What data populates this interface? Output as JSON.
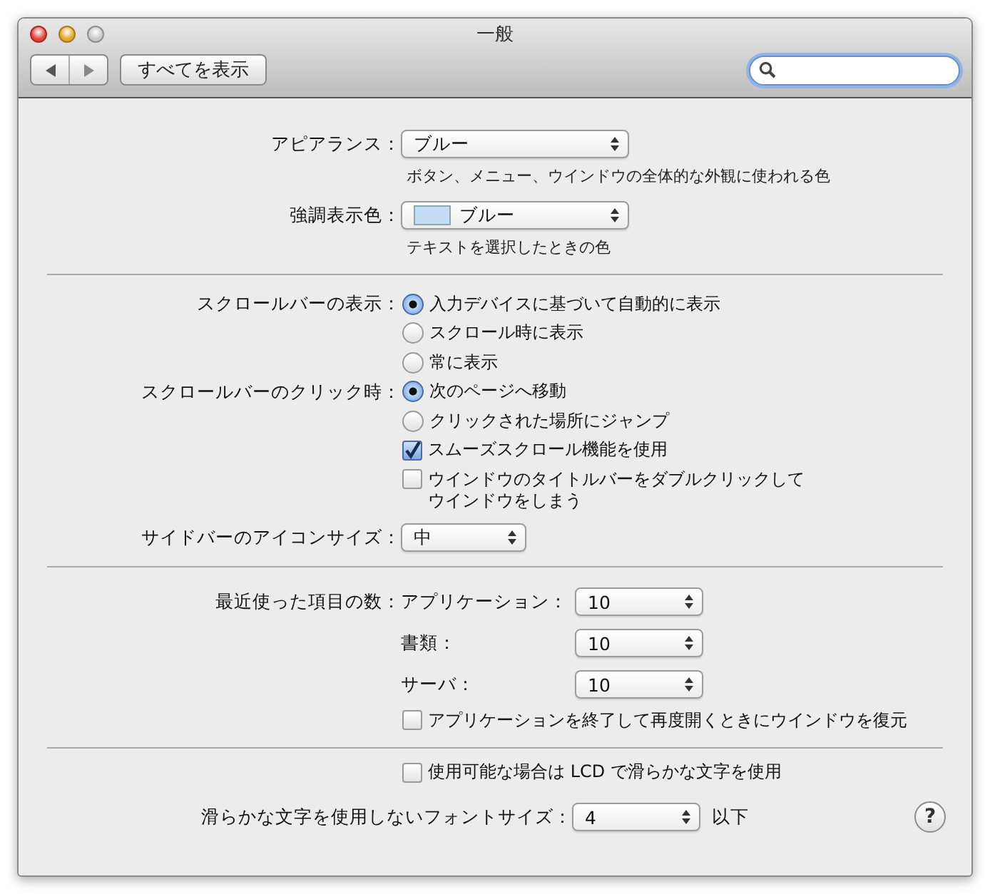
{
  "window": {
    "title": "一般"
  },
  "toolbar": {
    "show_all": "すべてを表示"
  },
  "appearance": {
    "label": "アピアランス：",
    "value": "ブルー",
    "hint": "ボタン、メニュー、ウインドウの全体的な外観に使われる色"
  },
  "highlight": {
    "label": "強調表示色：",
    "color": "#c5dcf7",
    "value": "ブルー",
    "hint": "テキストを選択したときの色"
  },
  "scroll_display": {
    "label": "スクロールバーの表示：",
    "options": [
      {
        "label": "入力デバイスに基づいて自動的に表示",
        "selected": true
      },
      {
        "label": "スクロール時に表示",
        "selected": false
      },
      {
        "label": "常に表示",
        "selected": false
      }
    ]
  },
  "scroll_click": {
    "label": "スクロールバーのクリック時：",
    "options": [
      {
        "label": "次のページへ移動",
        "selected": true
      },
      {
        "label": "クリックされた場所にジャンプ",
        "selected": false
      }
    ]
  },
  "scroll_checks": [
    {
      "label": "スムーズスクロール機能を使用",
      "checked": true
    },
    {
      "label": "ウインドウのタイトルバーをダブルクリックしてウインドウをしまう",
      "checked": false
    }
  ],
  "sidebar_icon_size": {
    "label": "サイドバーのアイコンサイズ：",
    "value": "中"
  },
  "recent_items": {
    "label": "最近使った項目の数：",
    "items": [
      {
        "label": "アプリケーション：",
        "value": "10"
      },
      {
        "label": "書類：",
        "value": "10"
      },
      {
        "label": "サーバ：",
        "value": "10"
      }
    ],
    "restore": {
      "label": "アプリケーションを終了して再度開くときにウインドウを復元",
      "checked": false
    }
  },
  "lcd_smoothing": {
    "label": "使用可能な場合は LCD で滑らかな文字を使用",
    "checked": false
  },
  "font_size": {
    "label": "滑らかな文字を使用しないフォントサイズ：",
    "value": "4",
    "suffix": "以下"
  },
  "help": "?"
}
